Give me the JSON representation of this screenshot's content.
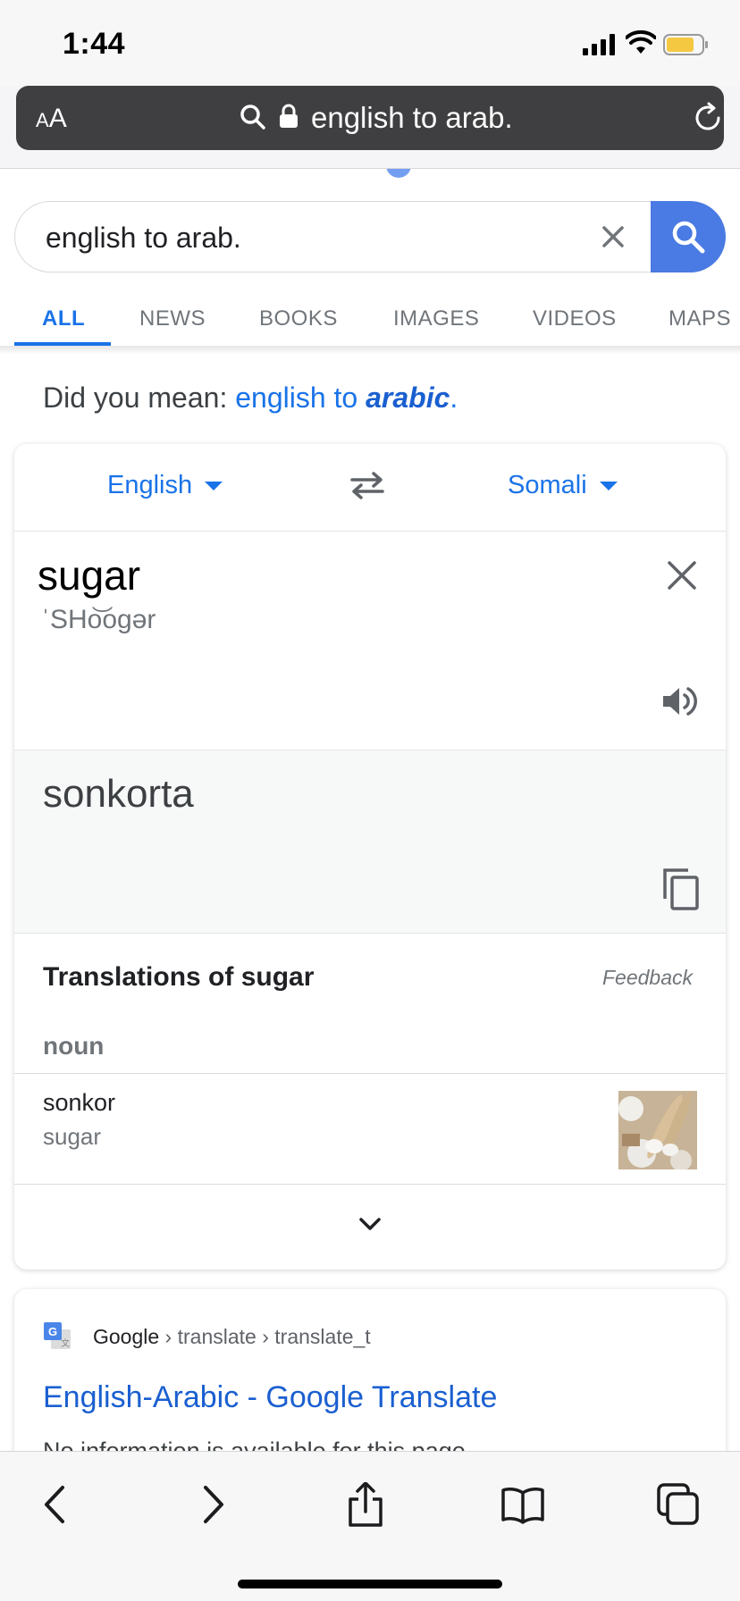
{
  "status": {
    "time": "1:44"
  },
  "browser": {
    "aa_label": "AA",
    "url_text": "english to arab."
  },
  "search": {
    "query": "english to arab."
  },
  "tabs": [
    "ALL",
    "NEWS",
    "BOOKS",
    "IMAGES",
    "VIDEOS",
    "MAPS"
  ],
  "did_you_mean": {
    "prefix": "Did you mean: ",
    "link_plain": "english to ",
    "link_bold": "arabic",
    "suffix": "."
  },
  "translate": {
    "source_lang": "English",
    "target_lang": "Somali",
    "source_word": "sugar",
    "phonetic": "ˈSHo͝ogər",
    "target_word": "sonkorta",
    "translations_prefix": "Translations of ",
    "translations_word": "sugar",
    "feedback": "Feedback",
    "part_of_speech": "noun",
    "entry_word": "sonkor",
    "entry_back": "sugar"
  },
  "result": {
    "site": "Google",
    "path1": "translate",
    "path2": "translate_t",
    "sep": " › ",
    "title": "English-Arabic - Google Translate",
    "snippet": "No information is available for this page."
  },
  "icons": [
    "search-icon",
    "lock-icon",
    "reload-icon",
    "close-icon",
    "swap-icon",
    "speaker-icon",
    "copy-icon",
    "chevron-down-icon",
    "back-icon",
    "forward-icon",
    "share-icon",
    "bookmarks-icon",
    "tabs-icon"
  ],
  "colors": {
    "accent": "#1a73e8",
    "search_button": "#4a7ae3",
    "address_bar": "#3f3f41"
  }
}
